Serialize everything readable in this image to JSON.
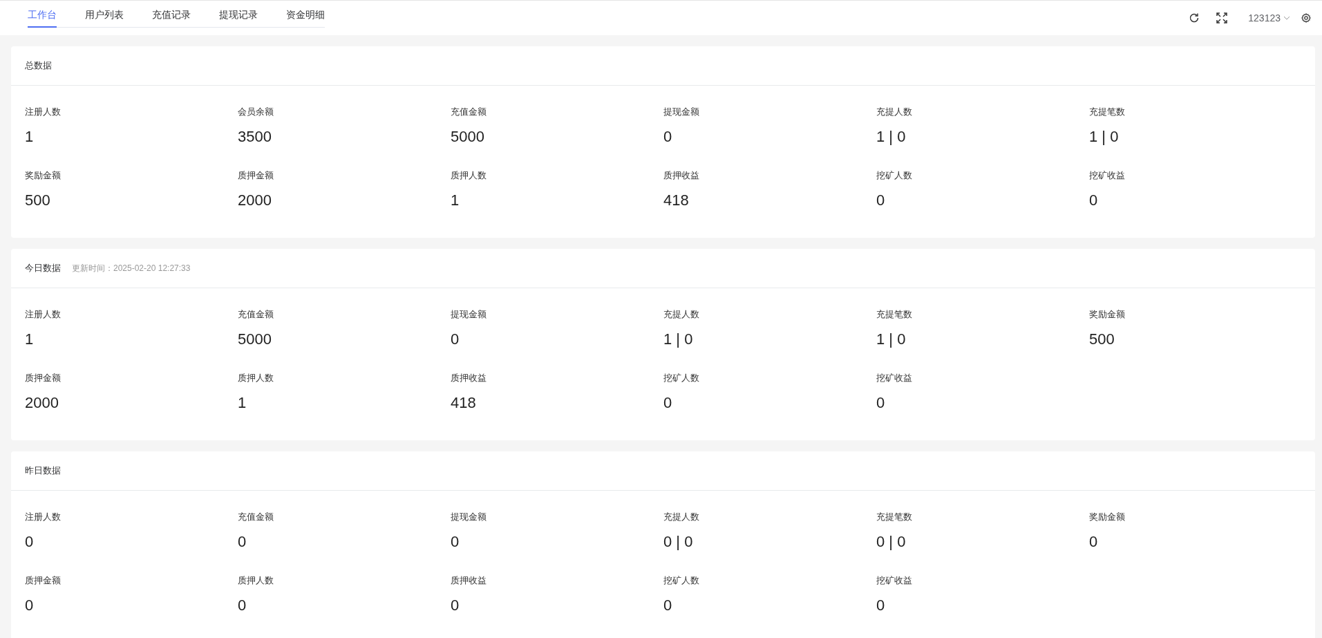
{
  "tabs": [
    {
      "label": "工作台",
      "selected": true
    },
    {
      "label": "用户列表",
      "selected": false
    },
    {
      "label": "充值记录",
      "selected": false
    },
    {
      "label": "提现记录",
      "selected": false
    },
    {
      "label": "资金明细",
      "selected": false
    }
  ],
  "header": {
    "user": "123123"
  },
  "sections": [
    {
      "title": "总数据",
      "stats": [
        {
          "label": "注册人数",
          "value": "1"
        },
        {
          "label": "会员余额",
          "value": "3500"
        },
        {
          "label": "充值金额",
          "value": "5000"
        },
        {
          "label": "提现金额",
          "value": "0"
        },
        {
          "label": "充提人数",
          "value": "1 | 0"
        },
        {
          "label": "充提笔数",
          "value": "1 | 0"
        },
        {
          "label": "奖励金额",
          "value": "500"
        },
        {
          "label": "质押金额",
          "value": "2000"
        },
        {
          "label": "质押人数",
          "value": "1"
        },
        {
          "label": "质押收益",
          "value": "418"
        },
        {
          "label": "挖矿人数",
          "value": "0"
        },
        {
          "label": "挖矿收益",
          "value": "0"
        }
      ]
    },
    {
      "title": "今日数据",
      "update_time": "更新时间：2025-02-20 12:27:33",
      "stats": [
        {
          "label": "注册人数",
          "value": "1"
        },
        {
          "label": "充值金额",
          "value": "5000"
        },
        {
          "label": "提现金额",
          "value": "0"
        },
        {
          "label": "充提人数",
          "value": "1 | 0"
        },
        {
          "label": "充提笔数",
          "value": "1 | 0"
        },
        {
          "label": "奖励金额",
          "value": "500"
        },
        {
          "label": "质押金额",
          "value": "2000"
        },
        {
          "label": "质押人数",
          "value": "1"
        },
        {
          "label": "质押收益",
          "value": "418"
        },
        {
          "label": "挖矿人数",
          "value": "0"
        },
        {
          "label": "挖矿收益",
          "value": "0"
        }
      ]
    },
    {
      "title": "昨日数据",
      "stats": [
        {
          "label": "注册人数",
          "value": "0"
        },
        {
          "label": "充值金额",
          "value": "0"
        },
        {
          "label": "提现金额",
          "value": "0"
        },
        {
          "label": "充提人数",
          "value": "0 | 0"
        },
        {
          "label": "充提笔数",
          "value": "0 | 0"
        },
        {
          "label": "奖励金额",
          "value": "0"
        },
        {
          "label": "质押金额",
          "value": "0"
        },
        {
          "label": "质押人数",
          "value": "0"
        },
        {
          "label": "质押收益",
          "value": "0"
        },
        {
          "label": "挖矿人数",
          "value": "0"
        },
        {
          "label": "挖矿收益",
          "value": "0"
        }
      ]
    }
  ]
}
